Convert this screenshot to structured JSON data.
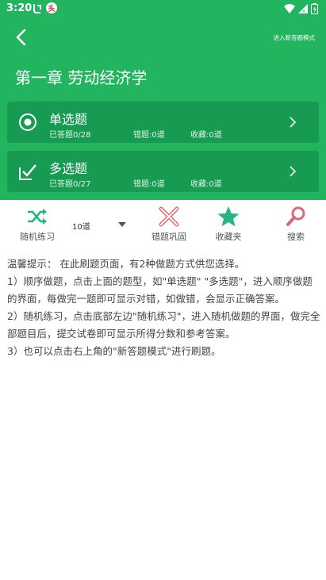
{
  "status_bar": {
    "time": "3:20",
    "badge_text": "头"
  },
  "header": {
    "mode_link": "进入新答题模式",
    "title": "第一章 劳动经济学"
  },
  "question_types": [
    {
      "title": "单选题",
      "answered": "已答题0/28",
      "wrong": "错题:0道",
      "favorites": "收藏:0道"
    },
    {
      "title": "多选题",
      "answered": "已答题0/27",
      "wrong": "错题:0道",
      "favorites": "收藏:0道"
    }
  ],
  "toolbar": {
    "random_label": "随机练习",
    "count_value": "10道",
    "wrong_label": "错题巩固",
    "favorites_label": "收藏夹",
    "search_label": "搜索"
  },
  "notice": {
    "line1": "温馨提示： 在此刷题页面，有2种做题方式供您选择。",
    "line2": "1）顺序做题，点击上面的题型，如\"单选题\" \"多选题\"，进入顺序做题的界面，每做完一题即可显示对错，如做错，会显示正确答案。",
    "line3": "2）随机练习，点击底部左边\"随机练习\"，进入随机做题的界面，做完全部题目后，提交试卷即可显示所得分数和参考答案。",
    "line4": "3）也可以点击右上角的\"新答题模式\"进行刷题。"
  },
  "colors": {
    "header_green": "#22b45f",
    "card_green": "#179a52",
    "wrong_red": "#e8696e",
    "star_teal": "#26b487",
    "search_red": "#d96a78"
  }
}
